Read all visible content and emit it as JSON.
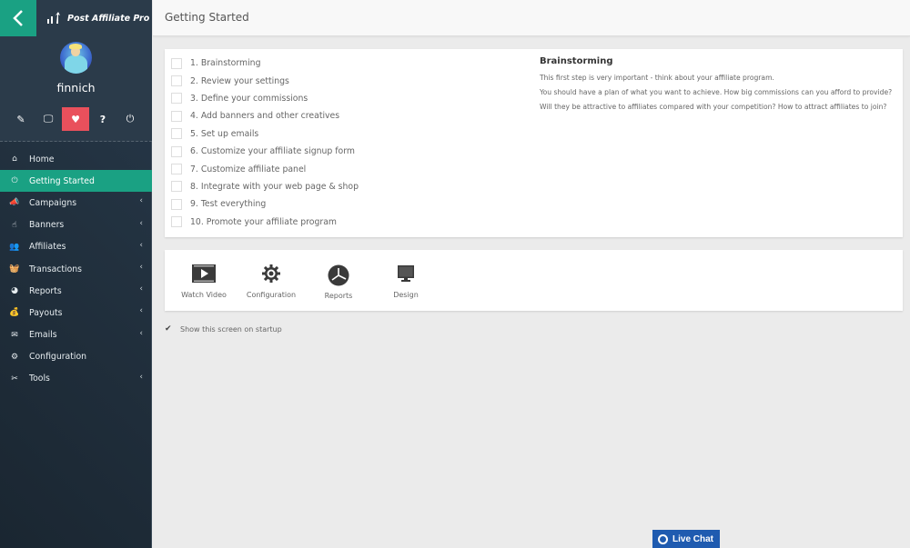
{
  "app": {
    "logo_text": "Post Affiliate Pro"
  },
  "user": {
    "name": "finnich"
  },
  "profile_icons": [
    {
      "name": "edit-icon",
      "glyph": "✎"
    },
    {
      "name": "monitor-icon",
      "glyph": "🖵"
    },
    {
      "name": "heartbeat-icon",
      "glyph": "♥"
    },
    {
      "name": "help-icon",
      "glyph": "?"
    },
    {
      "name": "power-icon",
      "glyph": "⏻"
    }
  ],
  "nav": [
    {
      "label": "Home",
      "icon": "⌂",
      "chevron": false,
      "active": false
    },
    {
      "label": "Getting Started",
      "icon": "⏻",
      "chevron": false,
      "active": true
    },
    {
      "label": "Campaigns",
      "icon": "📣",
      "chevron": true,
      "active": false
    },
    {
      "label": "Banners",
      "icon": "☝",
      "chevron": true,
      "active": false
    },
    {
      "label": "Affiliates",
      "icon": "👥",
      "chevron": true,
      "active": false
    },
    {
      "label": "Transactions",
      "icon": "🧺",
      "chevron": true,
      "active": false
    },
    {
      "label": "Reports",
      "icon": "◕",
      "chevron": true,
      "active": false
    },
    {
      "label": "Payouts",
      "icon": "💰",
      "chevron": true,
      "active": false
    },
    {
      "label": "Emails",
      "icon": "✉",
      "chevron": true,
      "active": false
    },
    {
      "label": "Configuration",
      "icon": "⚙",
      "chevron": false,
      "active": false
    },
    {
      "label": "Tools",
      "icon": "✂",
      "chevron": true,
      "active": false
    }
  ],
  "nav_chevron": "‹",
  "header": {
    "title": "Getting Started"
  },
  "steps": [
    {
      "label": "1. Brainstorming",
      "checked": false
    },
    {
      "label": "2. Review your settings",
      "checked": false
    },
    {
      "label": "3. Define your commissions",
      "checked": false
    },
    {
      "label": "4. Add banners and other creatives",
      "checked": false
    },
    {
      "label": "5. Set up emails",
      "checked": false
    },
    {
      "label": "6. Customize your affiliate signup form",
      "checked": false
    },
    {
      "label": "7. Customize affiliate panel",
      "checked": false
    },
    {
      "label": "8. Integrate with your web page & shop",
      "checked": false
    },
    {
      "label": "9. Test everything",
      "checked": false
    },
    {
      "label": "10. Promote your affiliate program",
      "checked": false
    }
  ],
  "detail": {
    "title": "Brainstorming",
    "lines": [
      "This first step is very important - think about your affiliate program.",
      "You should have a plan of what you want to achieve. How big commissions can you afford to provide?",
      "Will they be attractive to affiliates compared with your competition? How to attract affiliates to join?"
    ]
  },
  "shortcuts": [
    {
      "label": "Watch Video",
      "icon": "video-icon"
    },
    {
      "label": "Configuration",
      "icon": "gear-icon"
    },
    {
      "label": "Reports",
      "icon": "pie-chart-icon"
    },
    {
      "label": "Design",
      "icon": "monitor-icon"
    }
  ],
  "startup": {
    "label": "Show this screen on startup",
    "checked": true,
    "check_glyph": "✔"
  },
  "live_chat": {
    "label": "Live Chat"
  },
  "colors": {
    "accent": "#1aa183",
    "active_icon": "#e9505c",
    "sidebar": "#22313f",
    "live_chat": "#1f5bb0"
  }
}
